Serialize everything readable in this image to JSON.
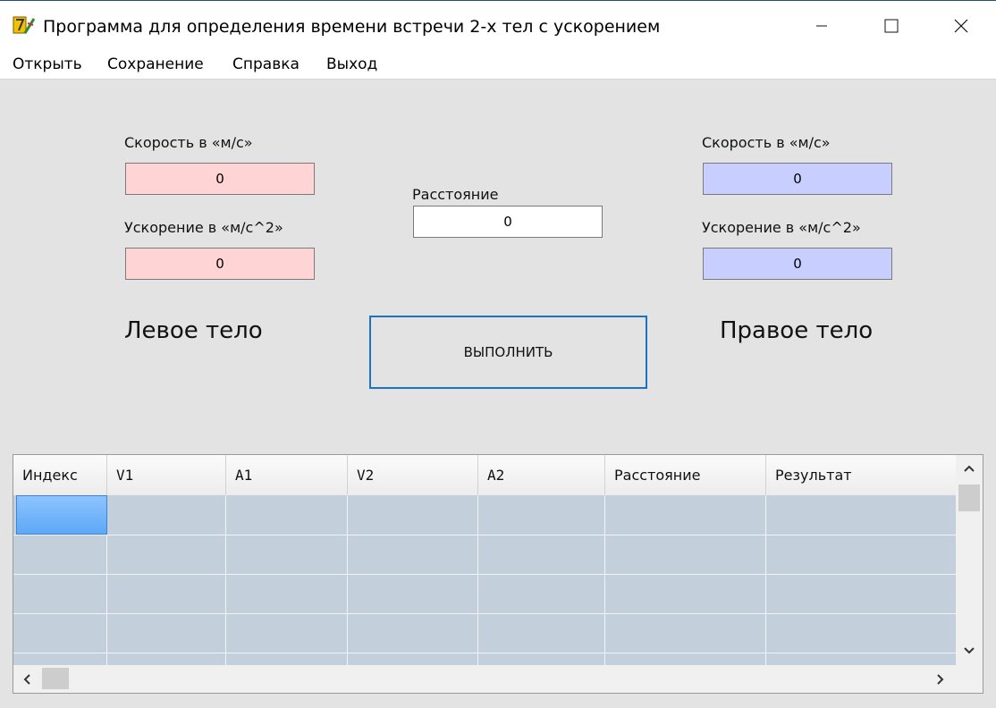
{
  "window": {
    "title": "Программа для определения времени встречи 2-х тел с ускорением"
  },
  "menu": {
    "items": [
      "Открыть",
      "Сохранение",
      "Справка",
      "Выход"
    ]
  },
  "left_body": {
    "speed_label": "Скорость в «м/с»",
    "speed_value": "0",
    "accel_label": "Ускорение в «м/с^2»",
    "accel_value": "0",
    "caption": "Левое тело"
  },
  "distance": {
    "label": "Расстояние",
    "value": "0"
  },
  "right_body": {
    "speed_label": "Скорость в «м/с»",
    "speed_value": "0",
    "accel_label": "Ускорение в «м/с^2»",
    "accel_value": "0",
    "caption": "Правое тело"
  },
  "run_button": {
    "label": "ВЫПОЛНИТЬ"
  },
  "grid": {
    "columns": [
      "Индекс",
      "V1",
      "A1",
      "V2",
      "A2",
      "Расстояние",
      "Результат"
    ]
  },
  "colors": {
    "left_field_bg": "#ffd4d4",
    "right_field_bg": "#c8cfff",
    "button_border": "#1a73c8",
    "grid_body": "#c3cfdb"
  }
}
